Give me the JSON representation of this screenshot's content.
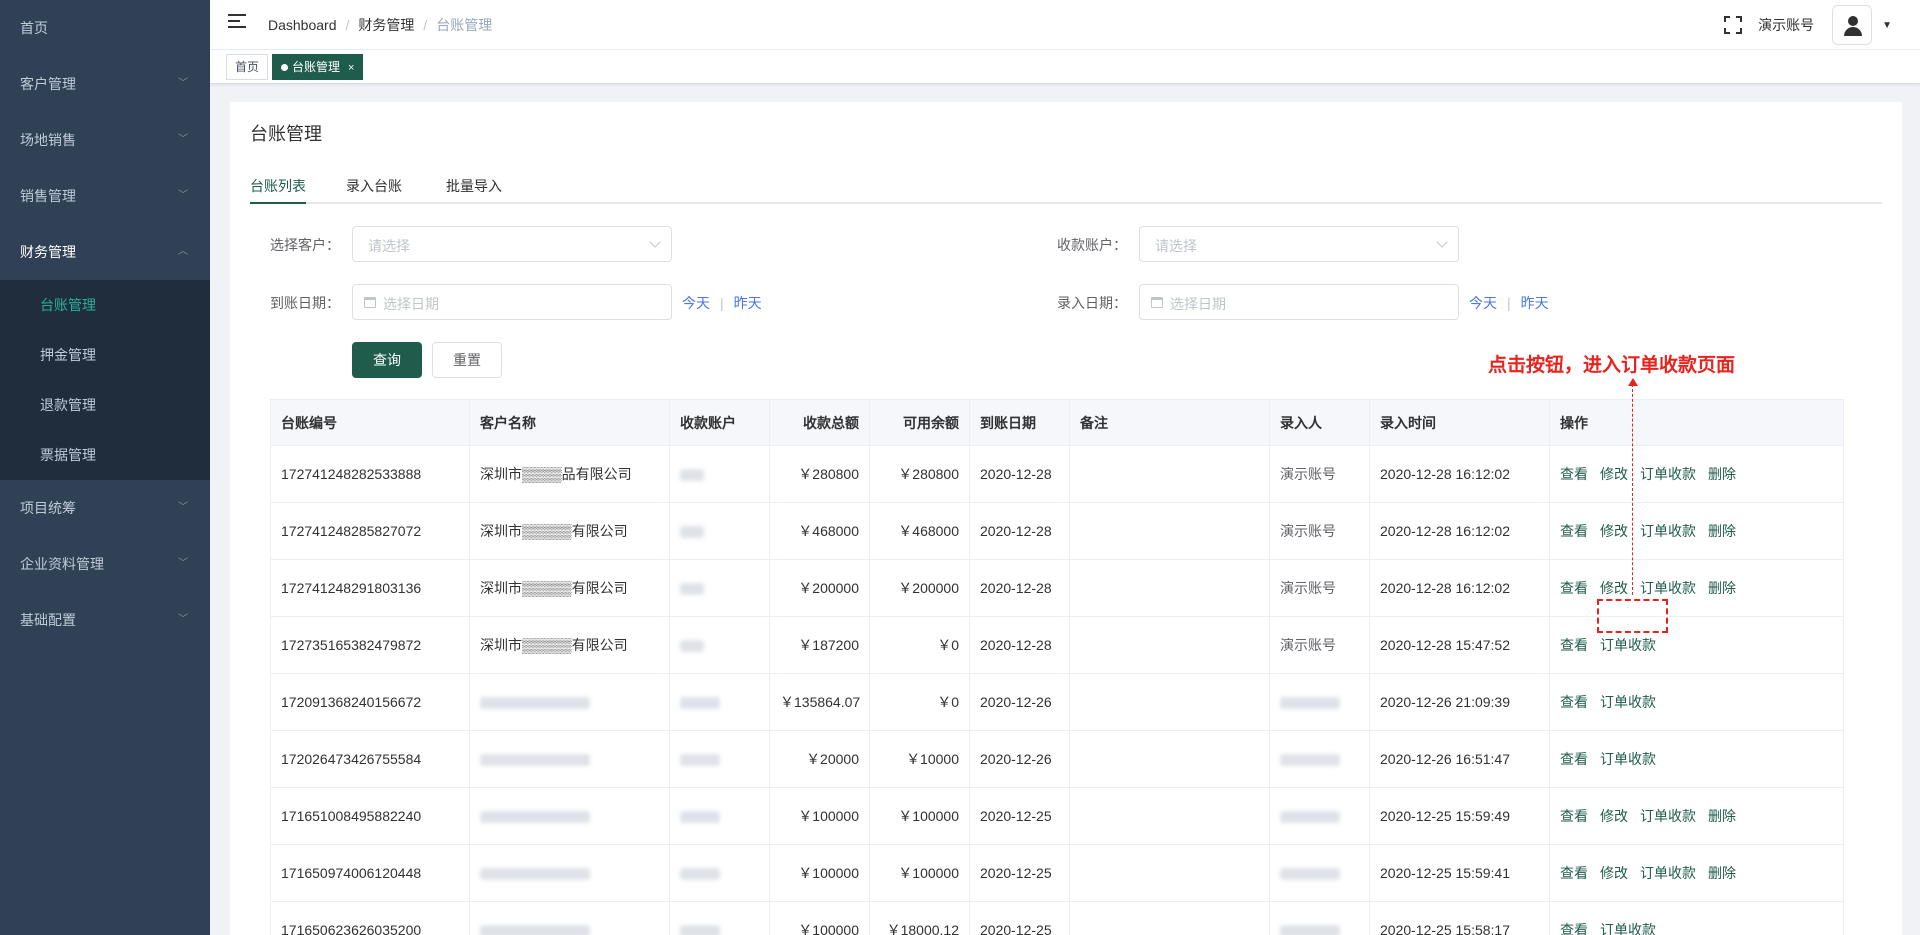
{
  "sidebar": {
    "items": [
      {
        "label": "首页",
        "chevron": false
      },
      {
        "label": "客户管理",
        "chevron": true
      },
      {
        "label": "场地销售",
        "chevron": true
      },
      {
        "label": "销售管理",
        "chevron": true
      },
      {
        "label": "财务管理",
        "chevron": true,
        "open": true
      },
      {
        "label": "项目统筹",
        "chevron": true
      },
      {
        "label": "企业资料管理",
        "chevron": true
      },
      {
        "label": "基础配置",
        "chevron": true
      }
    ],
    "finance_sub": [
      "台账管理",
      "押金管理",
      "退款管理",
      "票据管理"
    ]
  },
  "header": {
    "breadcrumb": [
      "Dashboard",
      "财务管理",
      "台账管理"
    ],
    "username": "演示账号"
  },
  "tags": [
    {
      "label": "首页",
      "active": false
    },
    {
      "label": "台账管理",
      "active": true,
      "close": "×"
    }
  ],
  "page": {
    "title": "台账管理",
    "tabs": [
      "台账列表",
      "录入台账",
      "批量导入"
    ]
  },
  "filters": {
    "customer_label": "选择客户：",
    "customer_placeholder": "请选择",
    "account_label": "收款账户：",
    "account_placeholder": "请选择",
    "arrival_label": "到账日期：",
    "arrival_placeholder": "选择日期",
    "entry_label": "录入日期：",
    "entry_placeholder": "选择日期",
    "today": "今天",
    "yesterday": "昨天",
    "query_button": "查询",
    "reset_button": "重置"
  },
  "annotation": {
    "text": "点击按钮，进入订单收款页面"
  },
  "table": {
    "columns": [
      "台账编号",
      "客户名称",
      "收款账户",
      "收款总额",
      "可用余额",
      "到账日期",
      "备注",
      "录入人",
      "录入时间",
      "操作"
    ],
    "rows": [
      {
        "id": "172741248282533888",
        "customer": "深圳市▒▒▒▒品有限公司",
        "total": "￥280800",
        "balance": "￥280800",
        "date": "2020-12-28",
        "entered_by": "演示账号",
        "entered_at": "2020-12-28 16:12:02",
        "ops": [
          "查看",
          "修改",
          "订单收款",
          "删除"
        ]
      },
      {
        "id": "172741248285827072",
        "customer": "深圳市▒▒▒▒▒有限公司",
        "total": "￥468000",
        "balance": "￥468000",
        "date": "2020-12-28",
        "entered_by": "演示账号",
        "entered_at": "2020-12-28 16:12:02",
        "ops": [
          "查看",
          "修改",
          "订单收款",
          "删除"
        ]
      },
      {
        "id": "172741248291803136",
        "customer": "深圳市▒▒▒▒▒有限公司",
        "total": "￥200000",
        "balance": "￥200000",
        "date": "2020-12-28",
        "entered_by": "演示账号",
        "entered_at": "2020-12-28 16:12:02",
        "ops": [
          "查看",
          "修改",
          "订单收款",
          "删除"
        ]
      },
      {
        "id": "172735165382479872",
        "customer": "深圳市▒▒▒▒▒有限公司",
        "total": "￥187200",
        "balance": "￥0",
        "date": "2020-12-28",
        "entered_by": "演示账号",
        "entered_at": "2020-12-28 15:47:52",
        "ops": [
          "查看",
          "订单收款"
        ]
      },
      {
        "id": "172091368240156672",
        "customer": "",
        "total": "￥135864.07",
        "balance": "￥0",
        "date": "2020-12-26",
        "entered_by": "",
        "entered_at": "2020-12-26 21:09:39",
        "ops": [
          "查看",
          "订单收款"
        ]
      },
      {
        "id": "172026473426755584",
        "customer": "",
        "total": "￥20000",
        "balance": "￥10000",
        "date": "2020-12-26",
        "entered_by": "",
        "entered_at": "2020-12-26 16:51:47",
        "ops": [
          "查看",
          "订单收款"
        ]
      },
      {
        "id": "171651008495882240",
        "customer": "",
        "total": "￥100000",
        "balance": "￥100000",
        "date": "2020-12-25",
        "entered_by": "",
        "entered_at": "2020-12-25 15:59:49",
        "ops": [
          "查看",
          "修改",
          "订单收款",
          "删除"
        ]
      },
      {
        "id": "171650974006120448",
        "customer": "",
        "total": "￥100000",
        "balance": "￥100000",
        "date": "2020-12-25",
        "entered_by": "",
        "entered_at": "2020-12-25 15:59:41",
        "ops": [
          "查看",
          "修改",
          "订单收款",
          "删除"
        ]
      },
      {
        "id": "171650623626035200",
        "customer": "",
        "total": "￥100000",
        "balance": "￥18000.12",
        "date": "2020-12-25",
        "entered_by": "",
        "entered_at": "2020-12-25 15:58:17",
        "ops": [
          "查看",
          "订单收款"
        ]
      }
    ]
  }
}
